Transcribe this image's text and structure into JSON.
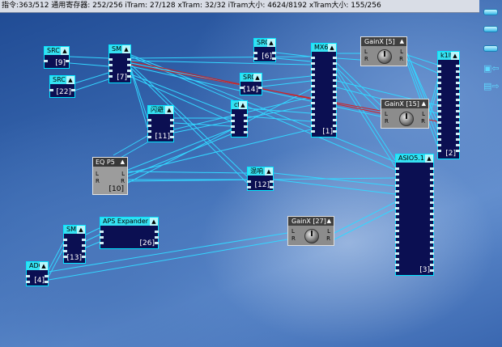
{
  "status_bar": {
    "text": "指令:363/512 通用寄存器: 252/256 iTram: 27/128 xTram: 32/32 iTram大小: 4624/8192 xTram大小: 155/256"
  },
  "modules": {
    "src9": {
      "title": "SRC",
      "number": "[9]"
    },
    "src22": {
      "title": "SRC",
      "number": "[22]"
    },
    "sm7": {
      "title": "SM",
      "number": "[7]"
    },
    "src6": {
      "title": "SRC",
      "number": "[6]"
    },
    "mx6": {
      "title": "MX6",
      "number": "[1]"
    },
    "src14": {
      "title": "SRC",
      "number": "[14]"
    },
    "shanbi11": {
      "title": "闪避",
      "number": "[11]"
    },
    "cf": {
      "title": "cf",
      "number": ""
    },
    "eqp5": {
      "title": "EQ P5",
      "number": "[10]",
      "in_l": "L",
      "in_r": "R",
      "out_l": "L",
      "out_r": "R"
    },
    "hunxiang12": {
      "title": "混响",
      "number": "[12]"
    },
    "gain5": {
      "title": "GainX [5]",
      "left": "L",
      "left2": "R",
      "right": "L",
      "right2": "R"
    },
    "gain15": {
      "title": "GainX [15]",
      "left": "L",
      "left2": "R",
      "right": "L",
      "right2": "R"
    },
    "k1lt": {
      "title": "k1lt",
      "number": "[2]"
    },
    "asio": {
      "title": "ASIO5.1",
      "number": "[3]"
    },
    "aps": {
      "title": "APS Expander",
      "number": "[26]"
    },
    "sm13": {
      "title": "SM",
      "number": "[13]"
    },
    "adc": {
      "title": "ADC",
      "number": "[4]"
    },
    "gain27": {
      "title": "GainX [27]",
      "left": "L",
      "left2": "R",
      "right": "L",
      "right2": "R"
    }
  },
  "side_toolbar": {
    "icons": [
      "menu-lines-icon",
      "menu-lines-icon",
      "export-arrow-icon",
      "folder-arrow-icon"
    ]
  },
  "colors": {
    "wire": "#33d6ff",
    "wire_red": "#d22020",
    "module_bg": "#0b0f52",
    "module_header": "#35e1f2"
  }
}
